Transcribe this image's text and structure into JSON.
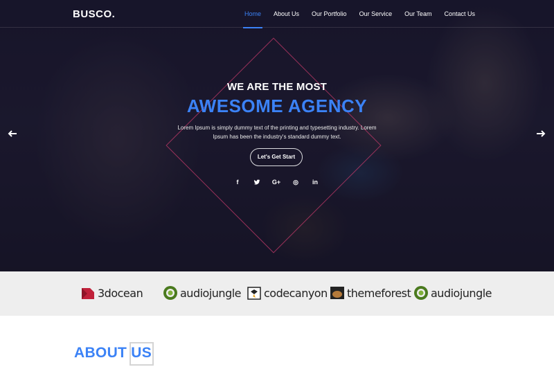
{
  "brand": "BUSCO.",
  "nav": {
    "items": [
      {
        "label": "Home"
      },
      {
        "label": "About Us"
      },
      {
        "label": "Our Portfolio"
      },
      {
        "label": "Our Service"
      },
      {
        "label": "Our Team"
      },
      {
        "label": "Contact Us"
      }
    ],
    "active": "Home"
  },
  "hero": {
    "tagline": "WE ARE THE MOST",
    "headline": "AWESOME AGENCY",
    "description": "Lorem Ipsum is simply dummy text of the printing and typesetting industry. Lorem Ipsum has been the industry's standard dummy text.",
    "cta": "Let's Get Start",
    "social": [
      {
        "icon": "facebook-icon",
        "glyph": "f"
      },
      {
        "icon": "twitter-icon",
        "glyph": "t"
      },
      {
        "icon": "google-plus-icon",
        "glyph": "G+"
      },
      {
        "icon": "dribbble-icon",
        "glyph": "◎"
      },
      {
        "icon": "linkedin-icon",
        "glyph": "in"
      }
    ]
  },
  "brands": [
    {
      "name": "3docean",
      "icon": "3docean-logo-icon"
    },
    {
      "name": "audiojungle",
      "icon": "audiojungle-logo-icon"
    },
    {
      "name": "codecanyon",
      "icon": "codecanyon-logo-icon"
    },
    {
      "name": "themeforest",
      "icon": "themeforest-logo-icon"
    },
    {
      "name": "audiojungle",
      "icon": "audiojungle-logo-icon"
    }
  ],
  "about": {
    "title": "ABOUT US"
  },
  "colors": {
    "accent": "#3b82f6",
    "diamond": "#cd3c6e",
    "brands_bg": "#eeeeee"
  }
}
